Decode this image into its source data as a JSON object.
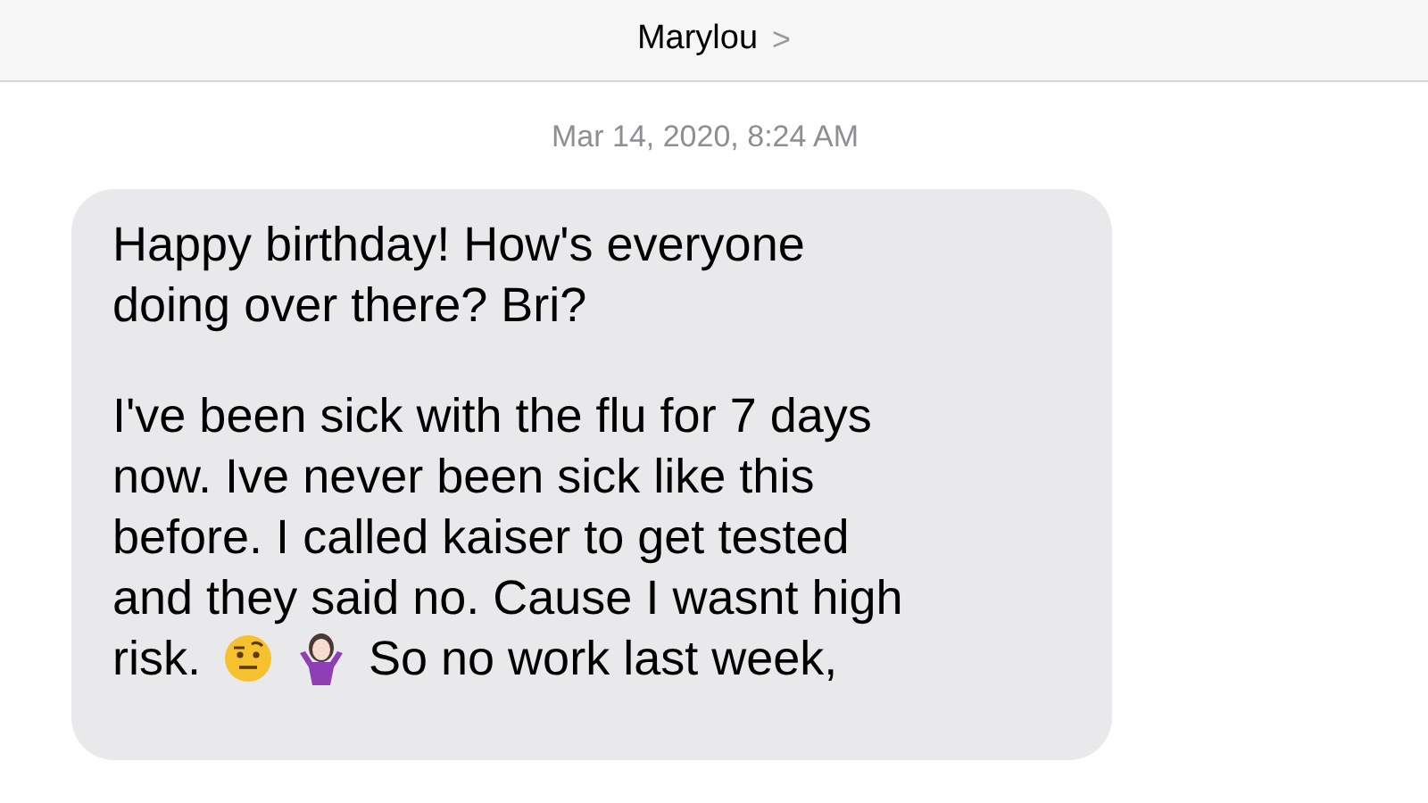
{
  "header": {
    "contact": "Marylou",
    "chevron": ">"
  },
  "timestamp": "Mar 14, 2020, 8:24 AM",
  "message": {
    "paragraphs": [
      [
        [
          {
            "kind": "text",
            "text": "Happy birthday! How's everyone"
          }
        ],
        [
          {
            "kind": "text",
            "text": "doing over there? Bri?"
          }
        ]
      ],
      [
        [
          {
            "kind": "text",
            "text": "I've been sick with the flu for 7 days"
          }
        ],
        [
          {
            "kind": "text",
            "text": "now. Ive never been sick like this"
          }
        ],
        [
          {
            "kind": "text",
            "text": "before. I called kaiser to get tested"
          }
        ],
        [
          {
            "kind": "text",
            "text": "and they said no. Cause I wasnt high"
          }
        ],
        [
          {
            "kind": "text",
            "text": "risk."
          },
          {
            "kind": "face-emoji"
          },
          {
            "kind": "shrug-emoji"
          },
          {
            "kind": "text",
            "text": "So no work last week,"
          }
        ]
      ]
    ]
  }
}
